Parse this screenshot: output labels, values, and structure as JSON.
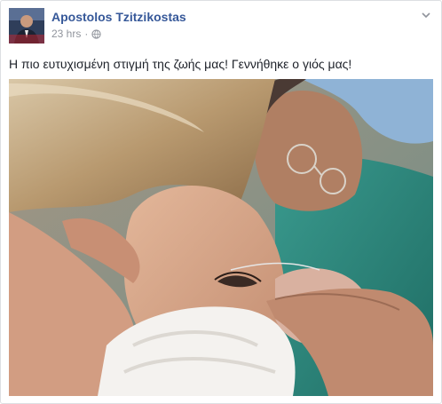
{
  "post": {
    "author": "Apostolos Tzitzikostas",
    "time": "23 hrs",
    "separator": "·",
    "audience_icon": "globe-icon",
    "menu_icon": "chevron-down-icon",
    "text": "Η πιο ευτυχισμένη στιγμή της ζωής μας! Γεννήθηκε ο γιός μας!",
    "photo": "hospital-newborn-photo"
  },
  "colors": {
    "author": "#365899",
    "meta": "#90949c",
    "text": "#1d2129",
    "border": "#dddfe2"
  }
}
